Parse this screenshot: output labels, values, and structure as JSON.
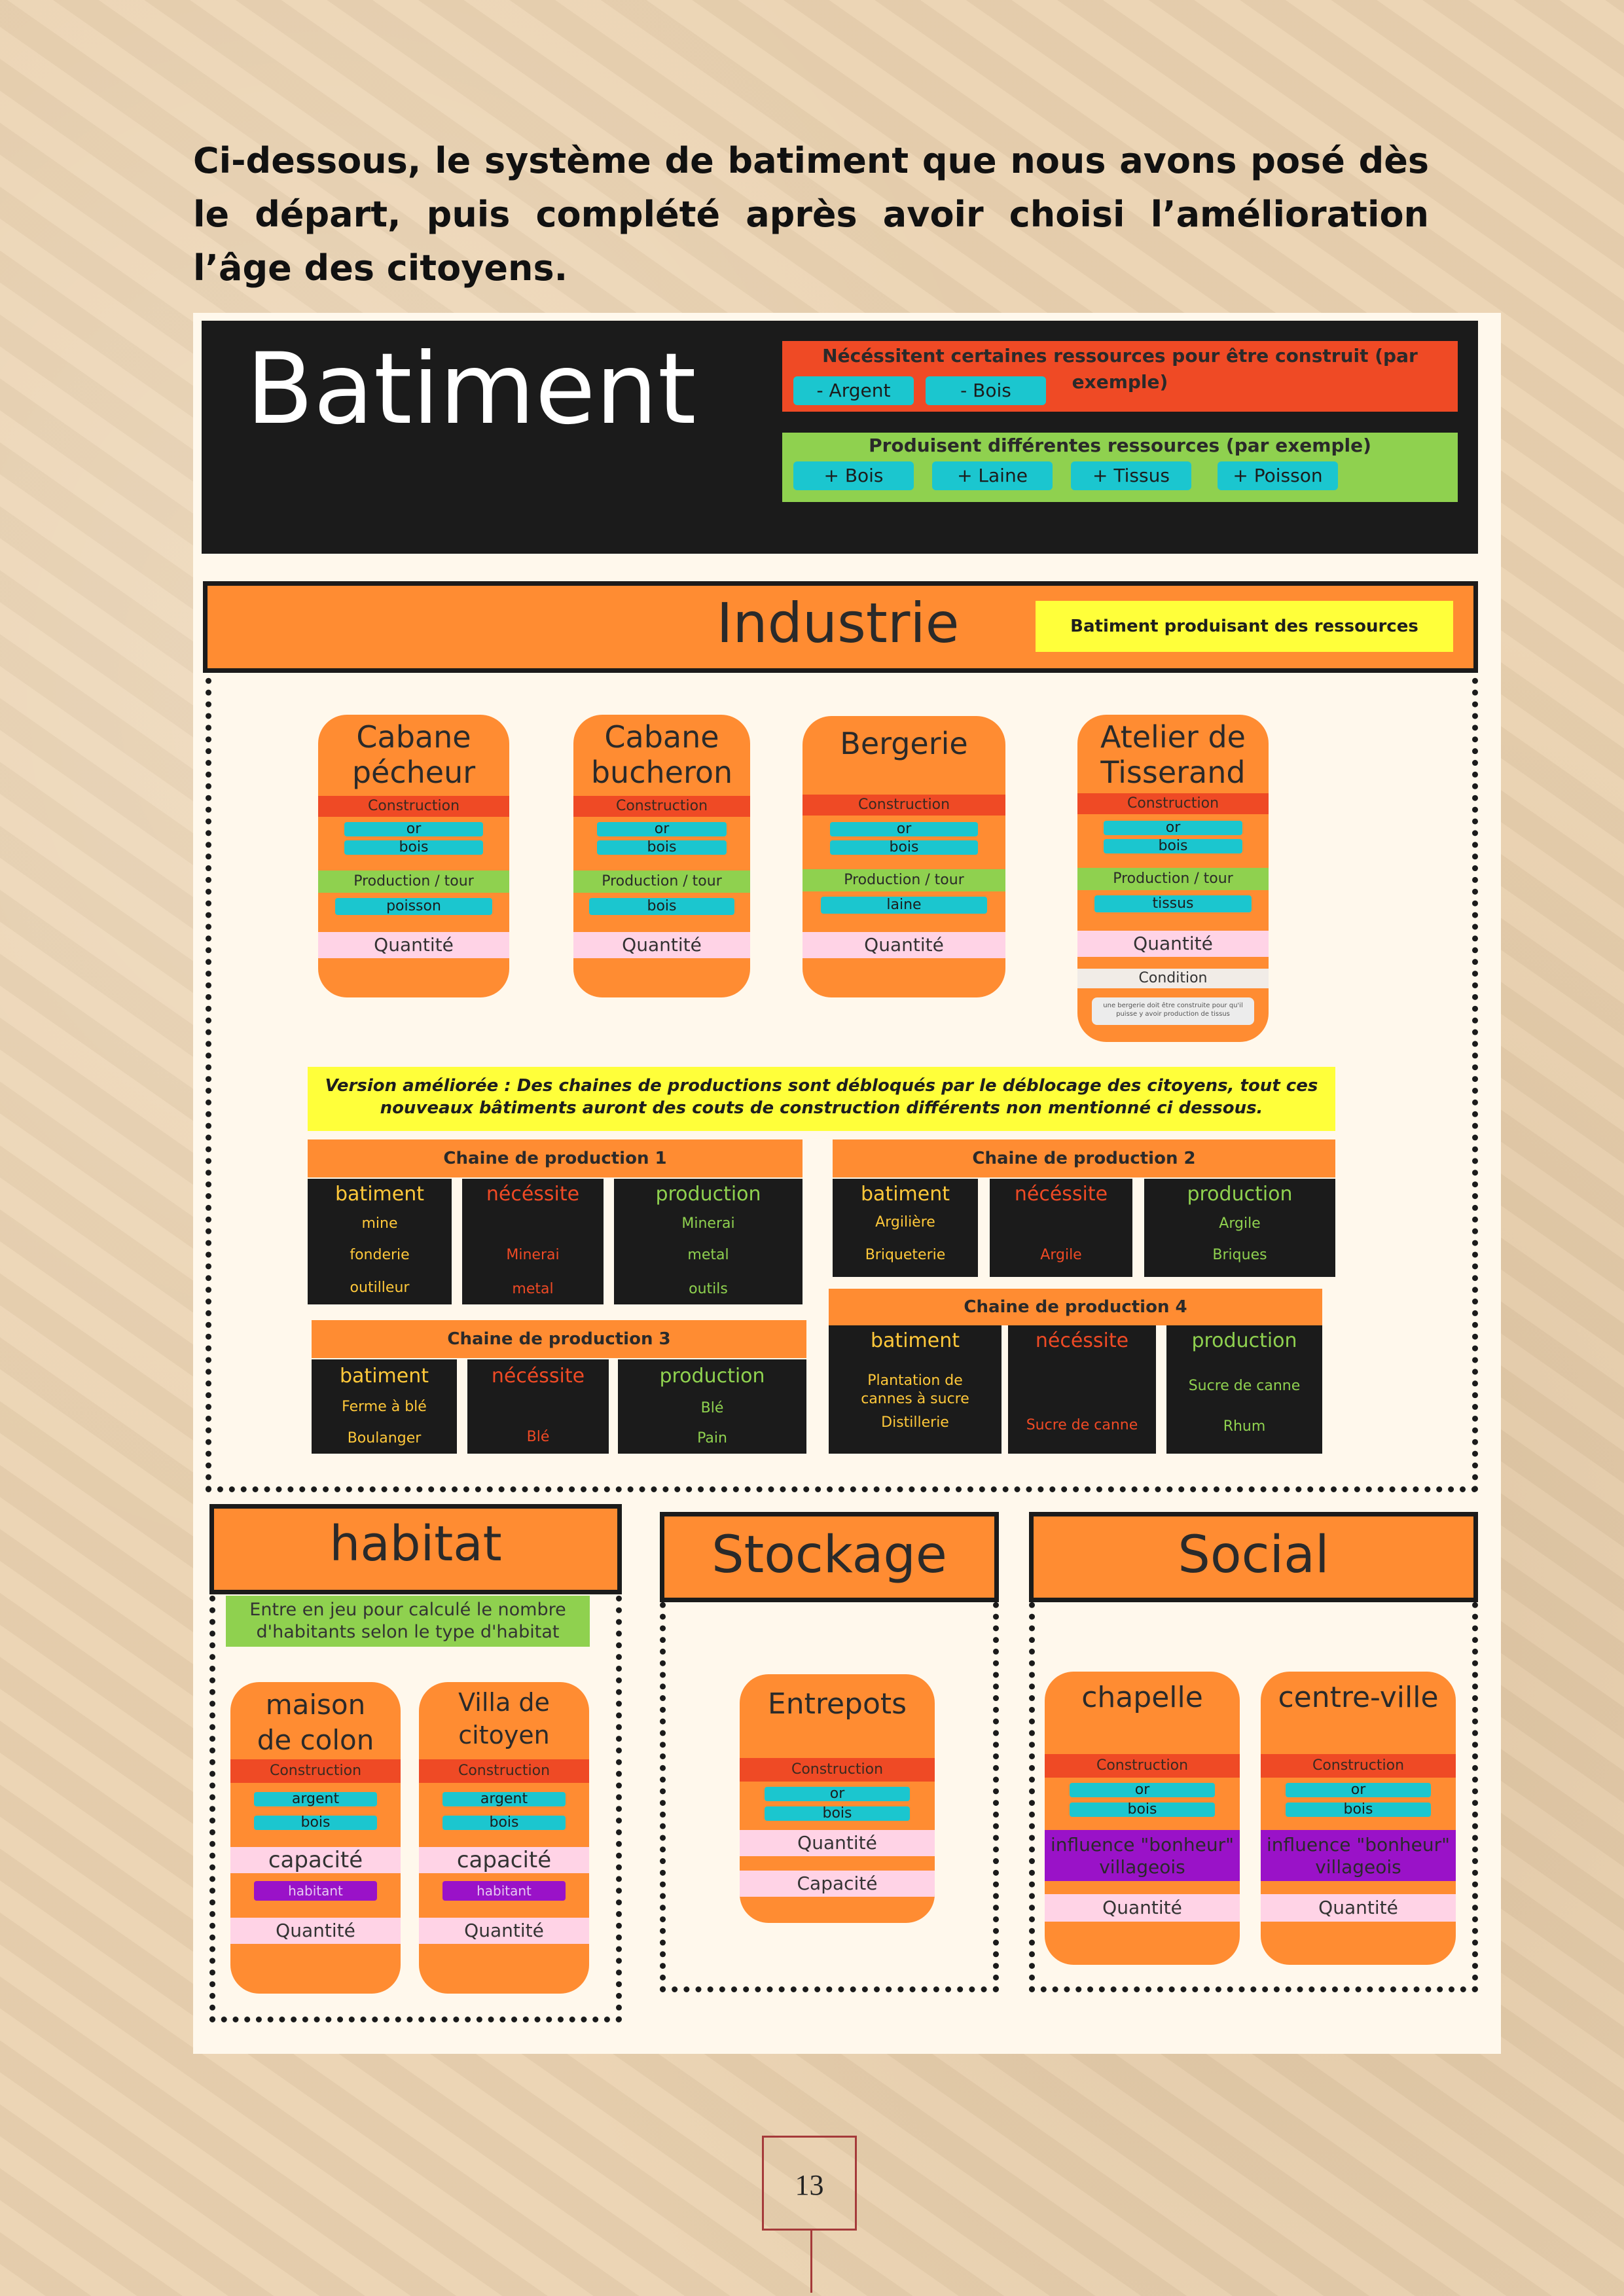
{
  "intro_text": "Ci-dessous, le système de batiment que nous avons posé dès le départ, puis complété après avoir choisi l’amélioration l’âge des citoyens.",
  "legend": {
    "title": "Batiment",
    "requires_text": "Nécéssitent certaines ressources pour être construit (par exemple)",
    "requires_chips": [
      "- Argent",
      "- Bois"
    ],
    "produces_text": "Produisent différentes ressources (par exemple)",
    "produces_chips": [
      "+ Bois",
      "+ Laine",
      "+ Tissus",
      "+ Poisson"
    ]
  },
  "industrie": {
    "title": "Industrie",
    "note": "Batiment produisant des ressources",
    "cards": [
      {
        "title1": "Cabane",
        "title2": "pécheur",
        "construction": "Construction",
        "c1": "or",
        "c2": "bois",
        "prod_label": "Production / tour",
        "prod": "poisson",
        "qty": "Quantité"
      },
      {
        "title1": "Cabane",
        "title2": "bucheron",
        "construction": "Construction",
        "c1": "or",
        "c2": "bois",
        "prod_label": "Production / tour",
        "prod": "bois",
        "qty": "Quantité"
      },
      {
        "title1": "Bergerie",
        "construction": "Construction",
        "c1": "or",
        "c2": "bois",
        "prod_label": "Production / tour",
        "prod": "laine",
        "qty": "Quantité"
      },
      {
        "title1": "Atelier de",
        "title2": "Tisserand",
        "construction": "Construction",
        "c1": "or",
        "c2": "bois",
        "prod_label": "Production / tour",
        "prod": "tissus",
        "qty": "Quantité",
        "condition": "Condition",
        "condition_note": "une bergerie doit être construite pour qu'il puisse y avoir production de tissus"
      }
    ],
    "version_note": "Version améliorée : Des chaines de productions sont débloqués par le déblocage des citoyens, tout ces nouveaux bâtiments auront des couts de construction différents non mentionné ci dessous.",
    "col_headers": {
      "batiment": "batiment",
      "necessite": "nécéssite",
      "production": "production"
    },
    "chains": [
      {
        "title": "Chaine de production 1",
        "batiment": [
          "mine",
          "fonderie",
          "outilleur"
        ],
        "necessite": [
          "",
          "Minerai",
          "metal"
        ],
        "production": [
          "Minerai",
          "metal",
          "outils"
        ]
      },
      {
        "title": "Chaine de production 2",
        "batiment": [
          "Argilière",
          "Briqueterie"
        ],
        "necessite": [
          "",
          "Argile"
        ],
        "production": [
          "Argile",
          "Briques"
        ]
      },
      {
        "title": "Chaine de production 3",
        "batiment": [
          "Ferme à blé",
          "Boulanger"
        ],
        "necessite": [
          "",
          "Blé"
        ],
        "production": [
          "Blé",
          "Pain"
        ]
      },
      {
        "title": "Chaine de production 4",
        "batiment": [
          "Plantation de",
          "cannes à sucre",
          "Distillerie"
        ],
        "necessite": [
          "",
          "Sucre de canne"
        ],
        "production": [
          "Sucre de canne",
          "Rhum"
        ]
      }
    ]
  },
  "habitat": {
    "title": "habitat",
    "note1": "Entre en jeu pour calculé le nombre",
    "note2": "d'habitants selon le type d'habitat",
    "cards": [
      {
        "title1": "maison",
        "title2": "de colon",
        "construction": "Construction",
        "c1": "argent",
        "c2": "bois",
        "cap": "capacité",
        "cap_chip": "habitant",
        "qty": "Quantité"
      },
      {
        "title1": "Villa de",
        "title2": "citoyen",
        "construction": "Construction",
        "c1": "argent",
        "c2": "bois",
        "cap": "capacité",
        "cap_chip": "habitant",
        "qty": "Quantité"
      }
    ]
  },
  "stockage": {
    "title": "Stockage",
    "card": {
      "title1": "Entrepots",
      "construction": "Construction",
      "c1": "or",
      "c2": "bois",
      "qty": "Quantité",
      "cap": "Capacité"
    }
  },
  "social": {
    "title": "Social",
    "cards": [
      {
        "title1": "chapelle",
        "construction": "Construction",
        "c1": "or",
        "c2": "bois",
        "infl1": "influence \"bonheur\"",
        "infl2": "villageois",
        "qty": "Quantité"
      },
      {
        "title1": "centre-ville",
        "construction": "Construction",
        "c1": "or",
        "c2": "bois",
        "infl1": "influence \"bonheur\"",
        "infl2": "villageois",
        "qty": "Quantité"
      }
    ]
  },
  "page_number": "13"
}
